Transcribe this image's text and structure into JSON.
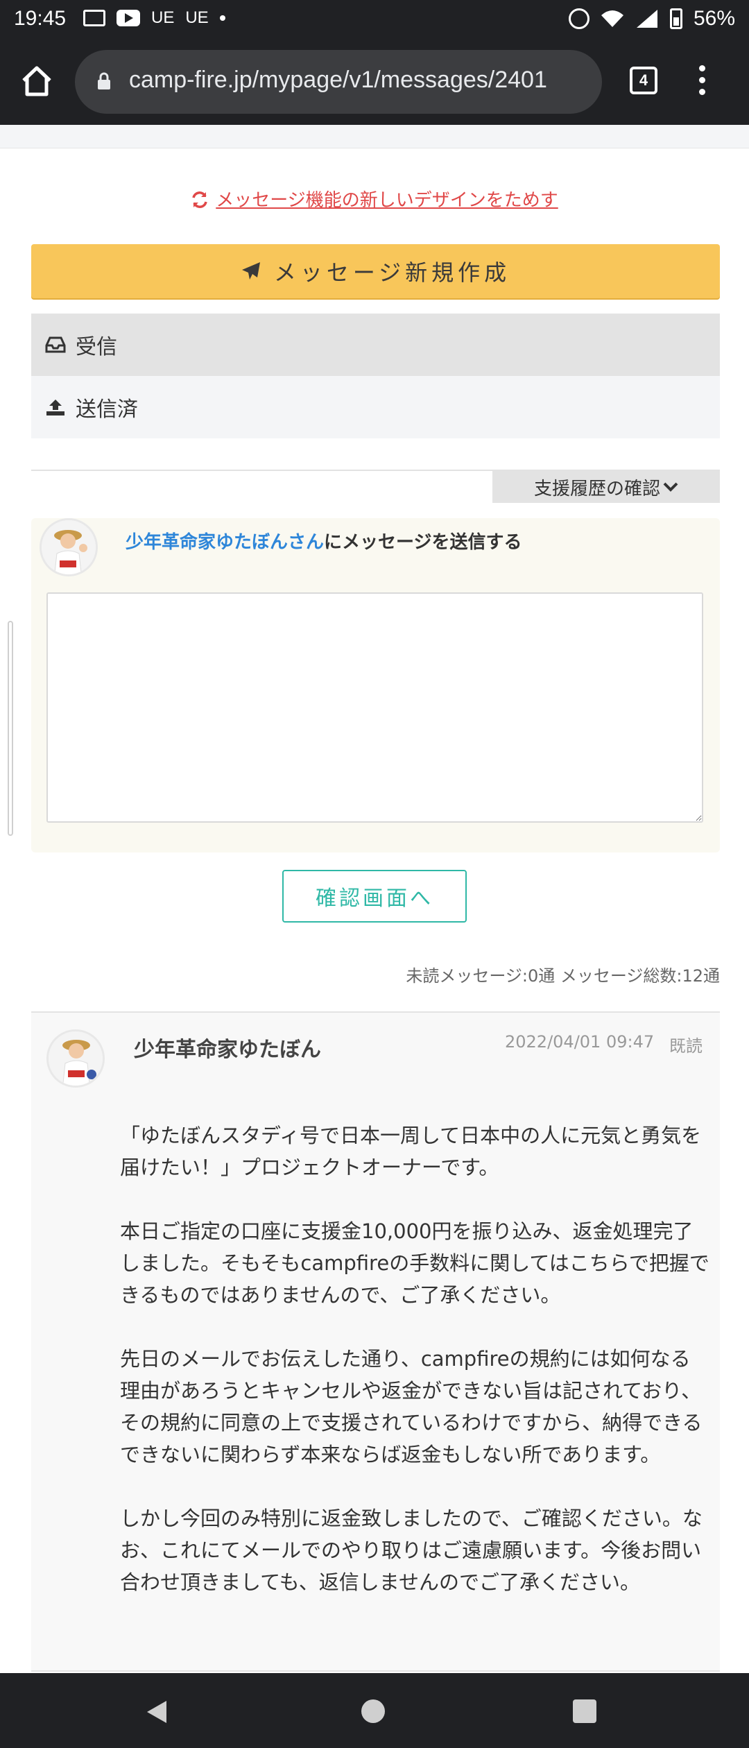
{
  "status_bar": {
    "time": "19:45",
    "ue1": "UE",
    "ue2": "UE",
    "battery": "56%"
  },
  "browser": {
    "url": "camp-fire.jp/mypage/v1/messages/2401",
    "tab_count": "4"
  },
  "try_new": {
    "label": "メッセージ機能の新しいデザインをためす",
    "icon": "refresh-icon"
  },
  "compose_button": {
    "label": "メッセージ新規作成",
    "icon": "paper-plane-icon"
  },
  "mail_nav": {
    "inbox": "受信",
    "sent": "送信済"
  },
  "history_button": "支援履歴の確認",
  "reply": {
    "name": "少年革命家ゆたぼんさん",
    "suffix": "にメッセージを送信する",
    "textarea_value": ""
  },
  "confirm_button": "確認画面へ",
  "counts": "未読メッセージ:0通 メッセージ総数:12通",
  "message": {
    "sender": "少年革命家ゆたぼん",
    "date": "2022/04/01 09:47",
    "read_status": "既読",
    "paragraphs": [
      "「ゆたぼんスタディ号で日本一周して日本中の人に元気と勇気を届けたい！」プロジェクトオーナーです。",
      "本日ご指定の口座に支援金10,000円を振り込み、返金処理完了しました。そもそもcampfireの手数料に関してはこちらで把握できるものではありませんので、ご了承ください。",
      "先日のメールでお伝えした通り、campfireの規約には如何なる理由があろうとキャンセルや返金ができない旨は記されており、その規約に同意の上で支援されているわけですから、納得できるできないに関わらず本来ならば返金もしない所であります。",
      "しかし今回のみ特別に返金致しましたので、ご確認ください。なお、これにてメールでのやり取りはご遠慮願います。今後お問い合わせ頂きましても、返信しませんのでご了承ください。"
    ]
  },
  "colors": {
    "accent_yellow": "#f8c65a",
    "link_red": "#e04848",
    "name_blue": "#2e86d9",
    "teal": "#2fb8a6"
  }
}
